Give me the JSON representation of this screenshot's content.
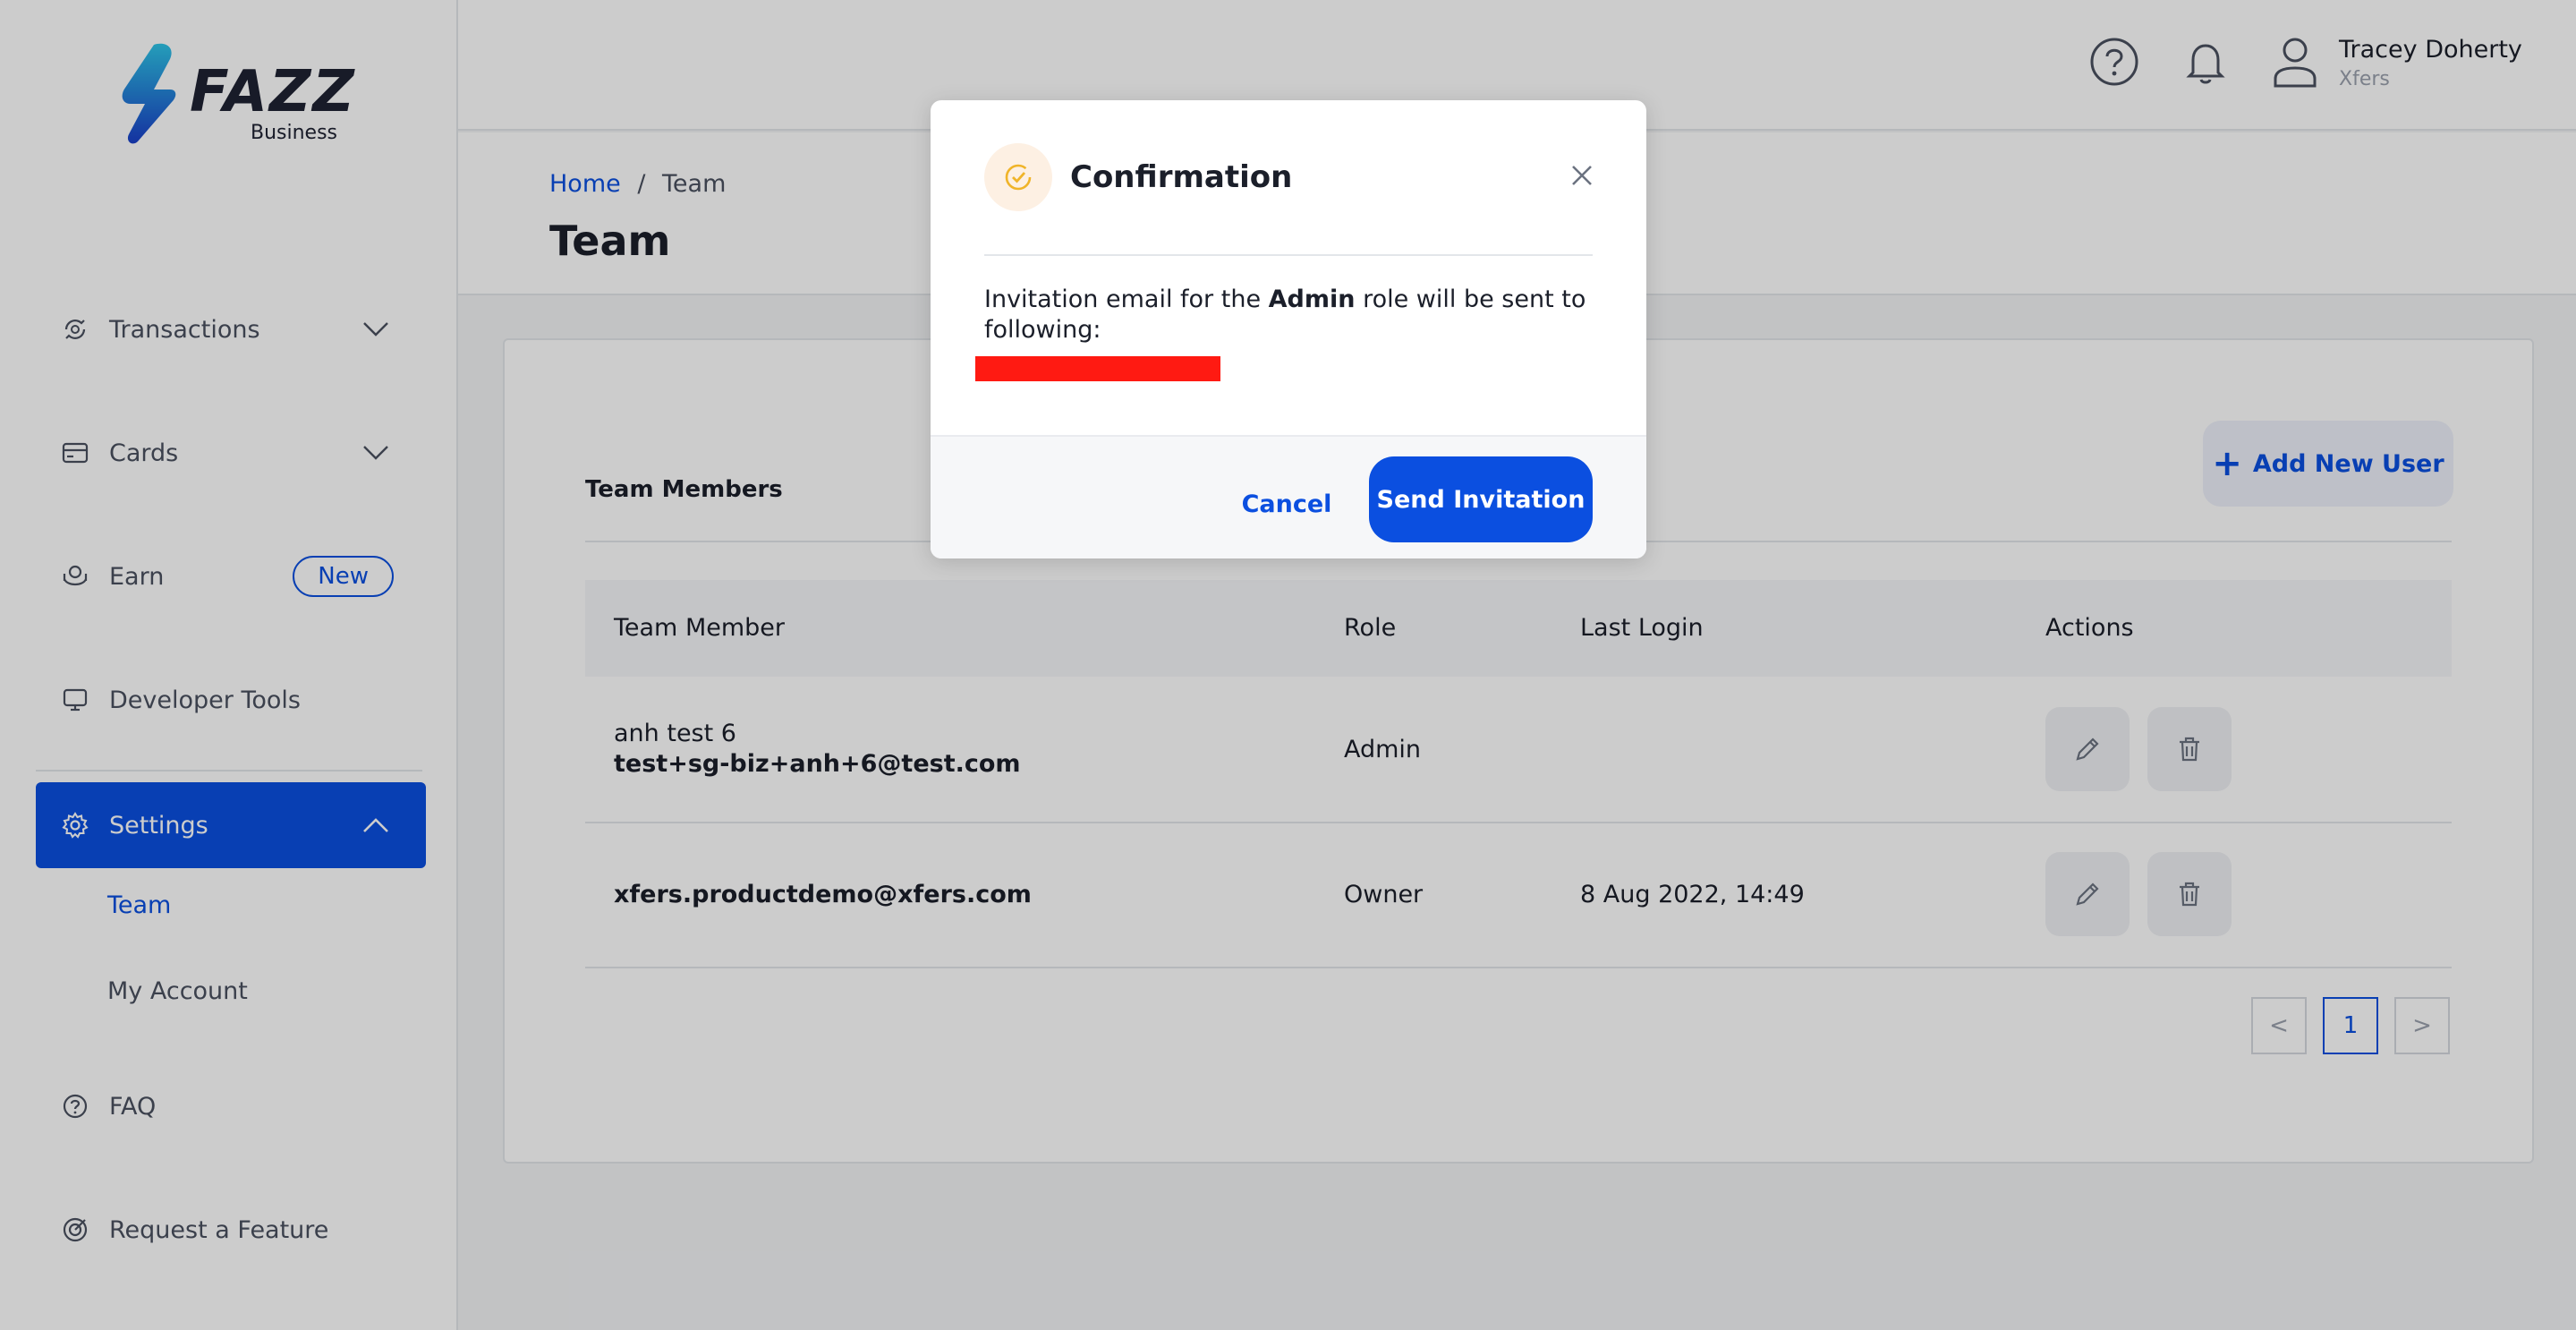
{
  "brand": {
    "name": "FAZZ",
    "sub": "Business",
    "accent": "#0b4fe0"
  },
  "sidebar": {
    "items": [
      {
        "label": "Transactions",
        "icon": "transactions-icon"
      },
      {
        "label": "Cards",
        "icon": "card-icon"
      },
      {
        "label": "Earn",
        "icon": "earn-icon",
        "badge": "New"
      },
      {
        "label": "Developer Tools",
        "icon": "monitor-icon"
      },
      {
        "label": "Settings",
        "icon": "gear-icon"
      },
      {
        "label": "FAQ",
        "icon": "help-icon"
      },
      {
        "label": "Request a Feature",
        "icon": "target-icon"
      }
    ],
    "settings_sub": [
      "Team",
      "My Account"
    ]
  },
  "header": {
    "user_name": "Tracey Doherty",
    "user_org": "Xfers"
  },
  "page": {
    "breadcrumb_home": "Home",
    "breadcrumb_sep": "/",
    "breadcrumb_current": "Team",
    "title": "Team"
  },
  "team": {
    "section_title": "Team Members",
    "add_button": "Add New User",
    "columns": [
      "Team Member",
      "Role",
      "Last Login",
      "Actions"
    ],
    "rows": [
      {
        "name": "anh test 6",
        "email": "test+sg-biz+anh+6@test.com",
        "role": "Admin",
        "last_login": ""
      },
      {
        "name": "",
        "email": "xfers.productdemo@xfers.com",
        "role": "Owner",
        "last_login": "8 Aug 2022, 14:49"
      }
    ],
    "pagination": {
      "prev": "<",
      "current": "1",
      "next": ">"
    }
  },
  "modal": {
    "title": "Confirmation",
    "body_prefix": "Invitation email for the ",
    "body_role": "Admin",
    "body_suffix": " role will be sent to following:",
    "cancel": "Cancel",
    "send": "Send Invitation"
  }
}
